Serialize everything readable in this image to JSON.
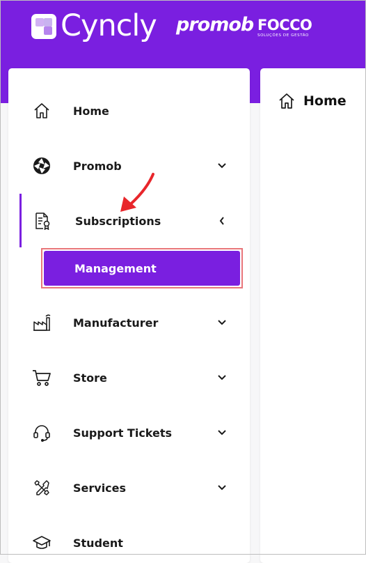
{
  "brand": {
    "cyncly": "Cyncly",
    "promob": "promob",
    "focco": "FOCCO",
    "focco_tagline": "SOLUÇÕES DE GESTÃO"
  },
  "colors": {
    "accent": "#7a1fe0",
    "highlight_outline": "#e8757a",
    "annotation_arrow": "#e8262b"
  },
  "sidebar": {
    "items": [
      {
        "label": "Home",
        "icon": "home-icon",
        "chevron": "none"
      },
      {
        "label": "Promob",
        "icon": "aperture-icon",
        "chevron": "down"
      },
      {
        "label": "Subscriptions",
        "icon": "certificate-icon",
        "chevron": "left",
        "active": true
      },
      {
        "label": "Manufacturer",
        "icon": "factory-icon",
        "chevron": "down"
      },
      {
        "label": "Store",
        "icon": "cart-icon",
        "chevron": "down"
      },
      {
        "label": "Support Tickets",
        "icon": "headset-icon",
        "chevron": "down"
      },
      {
        "label": "Services",
        "icon": "tools-icon",
        "chevron": "down"
      },
      {
        "label": "Student",
        "icon": "graduation-cap-icon",
        "chevron": "none"
      }
    ],
    "submenu": {
      "label": "Management"
    }
  },
  "content": {
    "title": "Home",
    "icon": "home-icon"
  },
  "annotation": {
    "icon": "red-arrow-icon"
  }
}
